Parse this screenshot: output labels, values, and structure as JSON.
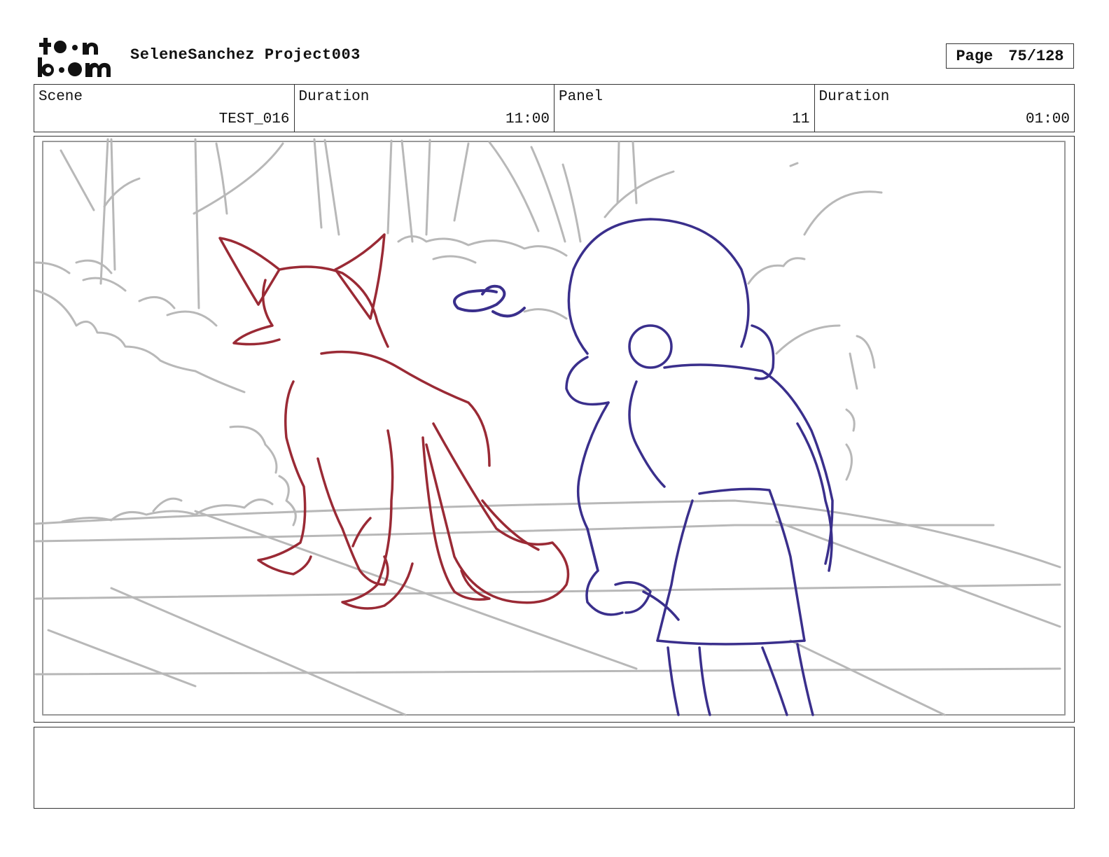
{
  "header": {
    "logo_text": "toon boom",
    "project_title": "SeleneSanchez Project003",
    "page_label": "Page",
    "page_number": "75/128"
  },
  "info": {
    "scene_label": "Scene",
    "scene_value": "TEST_016",
    "scene_duration_label": "Duration",
    "scene_duration_value": "11:00",
    "panel_label": "Panel",
    "panel_value": "11",
    "panel_duration_label": "Duration",
    "panel_duration_value": "01:00"
  },
  "panel": {
    "colors": {
      "background_sketch": "#b8b8b8",
      "fox": "#9a2a35",
      "girl": "#3a2f8c"
    }
  },
  "notes": {
    "text": ""
  }
}
